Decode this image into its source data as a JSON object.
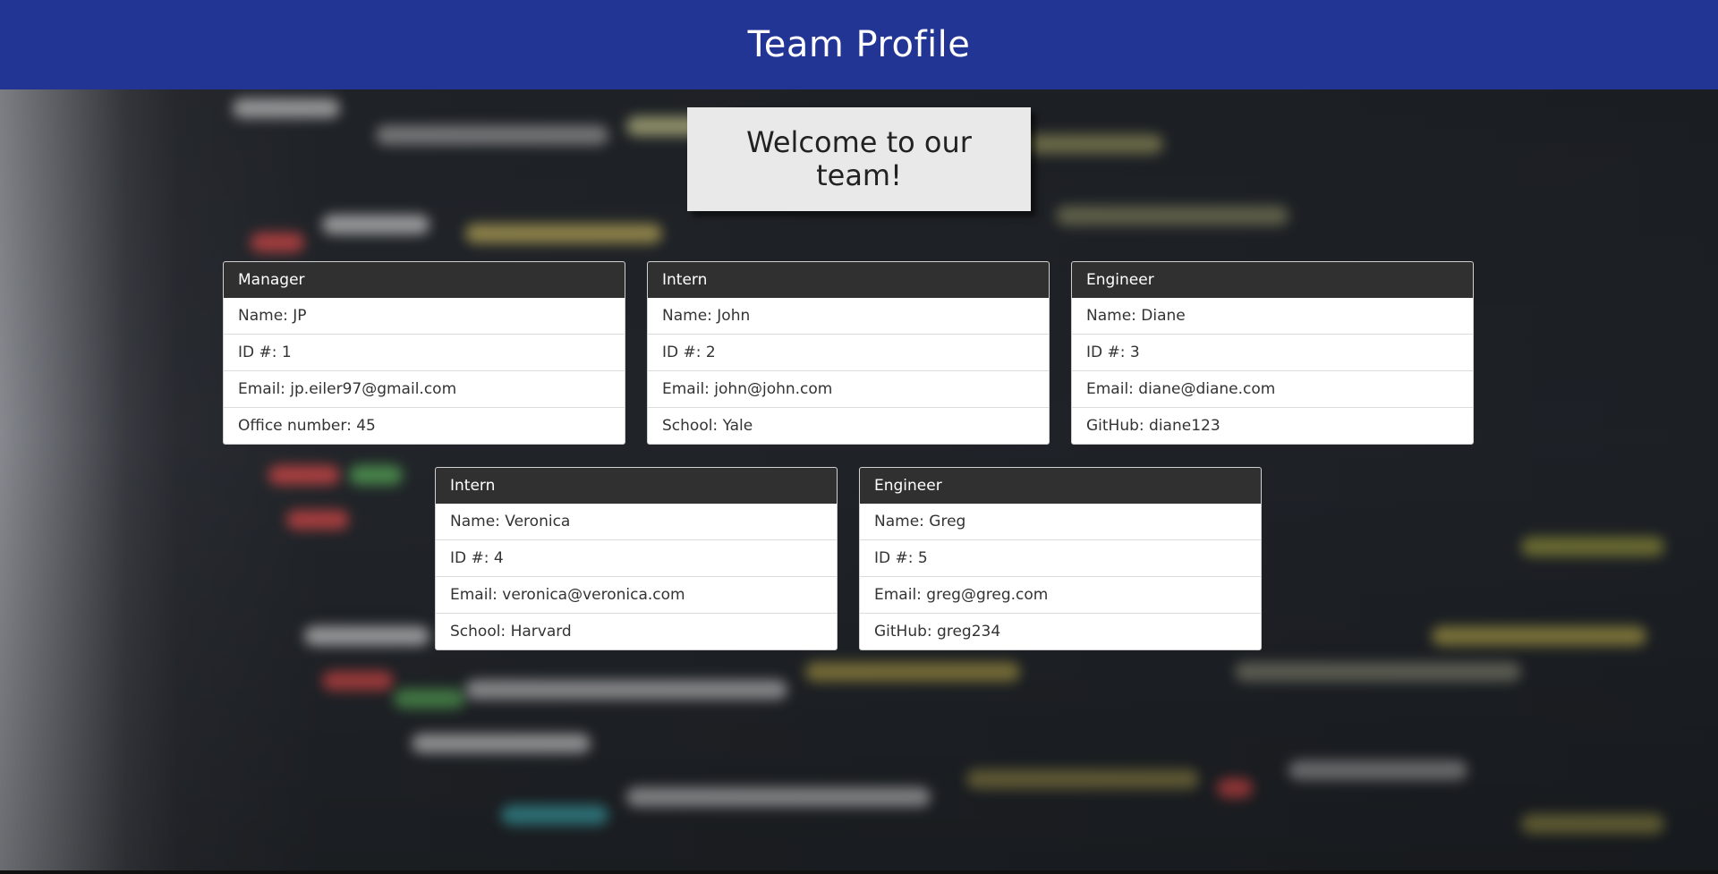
{
  "header": {
    "title": "Team Profile"
  },
  "welcome": {
    "text": "Welcome to our team!"
  },
  "cards": [
    {
      "role": "Manager",
      "name": "Name: JP",
      "id": "ID #: 1",
      "email": "Email: jp.eiler97@gmail.com",
      "extra": "Office number: 45"
    },
    {
      "role": "Intern",
      "name": "Name: John",
      "id": "ID #: 2",
      "email": "Email: john@john.com",
      "extra": "School: Yale"
    },
    {
      "role": "Engineer",
      "name": "Name: Diane",
      "id": "ID #: 3",
      "email": "Email: diane@diane.com",
      "extra": "GitHub: diane123"
    },
    {
      "role": "Intern",
      "name": "Name: Veronica",
      "id": "ID #: 4",
      "email": "Email: veronica@veronica.com",
      "extra": "School: Harvard"
    },
    {
      "role": "Engineer",
      "name": "Name: Greg",
      "id": "ID #: 5",
      "email": "Email: greg@greg.com",
      "extra": "GitHub: greg234"
    }
  ],
  "colors": {
    "banner": "#223594",
    "card_header": "#303030",
    "welcome_box": "#e9e9e9"
  }
}
